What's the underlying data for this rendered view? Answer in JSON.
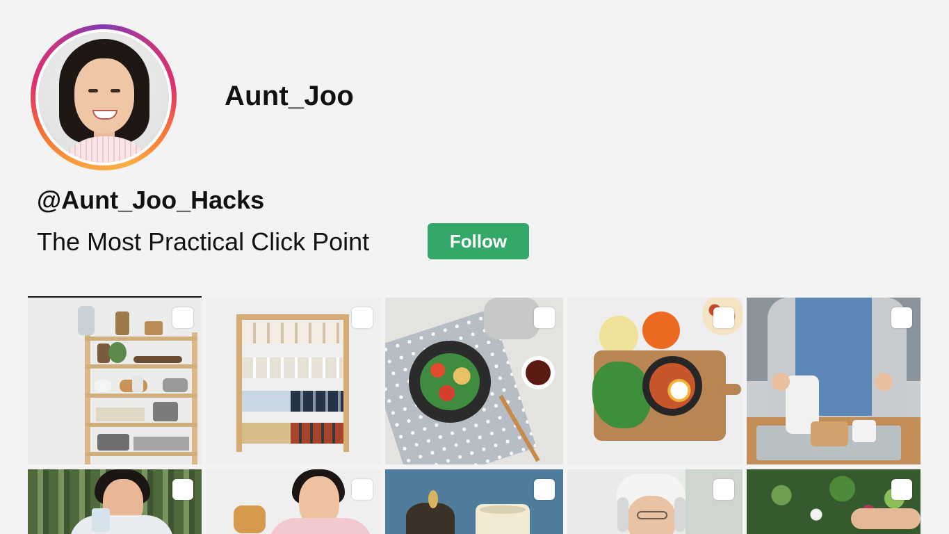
{
  "profile": {
    "display_name": "Aunt_Joo",
    "handle": "@Aunt_Joo_Hacks",
    "bio": "The Most Practical Click Point",
    "follow_label": "Follow"
  },
  "colors": {
    "follow_button": "#34a868",
    "avatar_ring_start": "#fcaf45",
    "avatar_ring_end": "#c13584"
  },
  "grid": {
    "tiles": [
      {
        "subject": "wooden pantry shelf with jars",
        "selected": false
      },
      {
        "subject": "wall spice rack with labeled jars",
        "selected": false
      },
      {
        "subject": "plate of stuffed vegetables with fork",
        "selected": false
      },
      {
        "subject": "cutting board with greens and egg bowl",
        "selected": false
      },
      {
        "subject": "person in apron holding jar",
        "selected": false
      },
      {
        "subject": "smiling woman holding glass outdoors",
        "selected": false
      },
      {
        "subject": "smiling woman holding toast",
        "selected": false
      },
      {
        "subject": "cup and figs on blue background",
        "selected": false
      },
      {
        "subject": "elderly woman in white hat",
        "selected": false
      },
      {
        "subject": "fresh vegetables and herbs",
        "selected": false
      }
    ]
  }
}
